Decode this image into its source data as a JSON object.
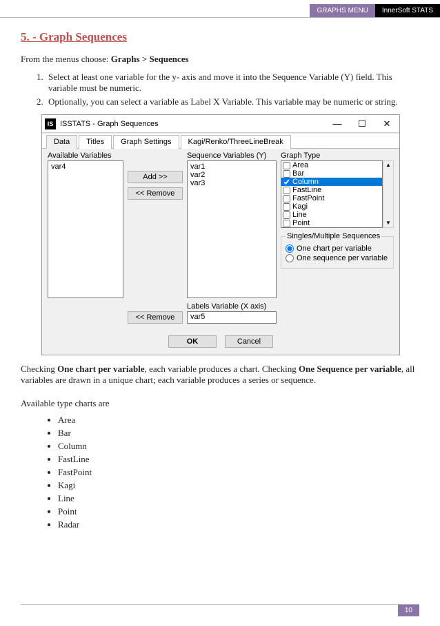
{
  "header": {
    "left": "GRAPHS MENU",
    "right": "InnerSoft STATS"
  },
  "section_title": "5. - Graph Sequences",
  "intro_prefix": "From the menus choose: ",
  "intro_bold": "Graphs > Sequences",
  "steps": [
    "Select at least one variable for the y- axis and move it into the Sequence Variable (Y) field. This variable must be numeric.",
    "Optionally, you can select a variable as Label X Variable. This variable may be numeric or string."
  ],
  "dialog": {
    "title": "ISSTATS - Graph Sequences",
    "icon": "IS",
    "win": {
      "min": "—",
      "max": "☐",
      "close": "✕"
    },
    "tabs": [
      "Data",
      "Titles",
      "Graph Settings",
      "Kagi/Renko/ThreeLineBreak"
    ],
    "available_lbl": "Available Variables",
    "available": [
      "var4"
    ],
    "seq_lbl": "Sequence Variables (Y)",
    "seq": [
      "var1",
      "var2",
      "var3"
    ],
    "add": "Add >>",
    "remove": "<< Remove",
    "gt_lbl": "Graph Type",
    "gt": [
      "Area",
      "Bar",
      "Column",
      "FastLine",
      "FastPoint",
      "Kagi",
      "Line",
      "Point"
    ],
    "gt_selected_index": 2,
    "sm_title": "Singles/Multiple Sequences",
    "sm_opts": [
      "One chart per variable",
      "One sequence per variable"
    ],
    "labelx_lbl": "Labels Variable (X axis)",
    "labelx_val": "var5",
    "ok": "OK",
    "cancel": "Cancel"
  },
  "para_parts": [
    "Checking ",
    "One chart per variable",
    ", each variable produces a chart. Checking ",
    "One Sequence per variable",
    ", all variables are drawn in a unique chart; each variable produces a series or sequence."
  ],
  "avail_label": "Available type charts are",
  "chart_types": [
    "Area",
    "Bar",
    "Column",
    "FastLine",
    "FastPoint",
    "Kagi",
    "Line",
    "Point",
    "Radar"
  ],
  "page_number": "10"
}
